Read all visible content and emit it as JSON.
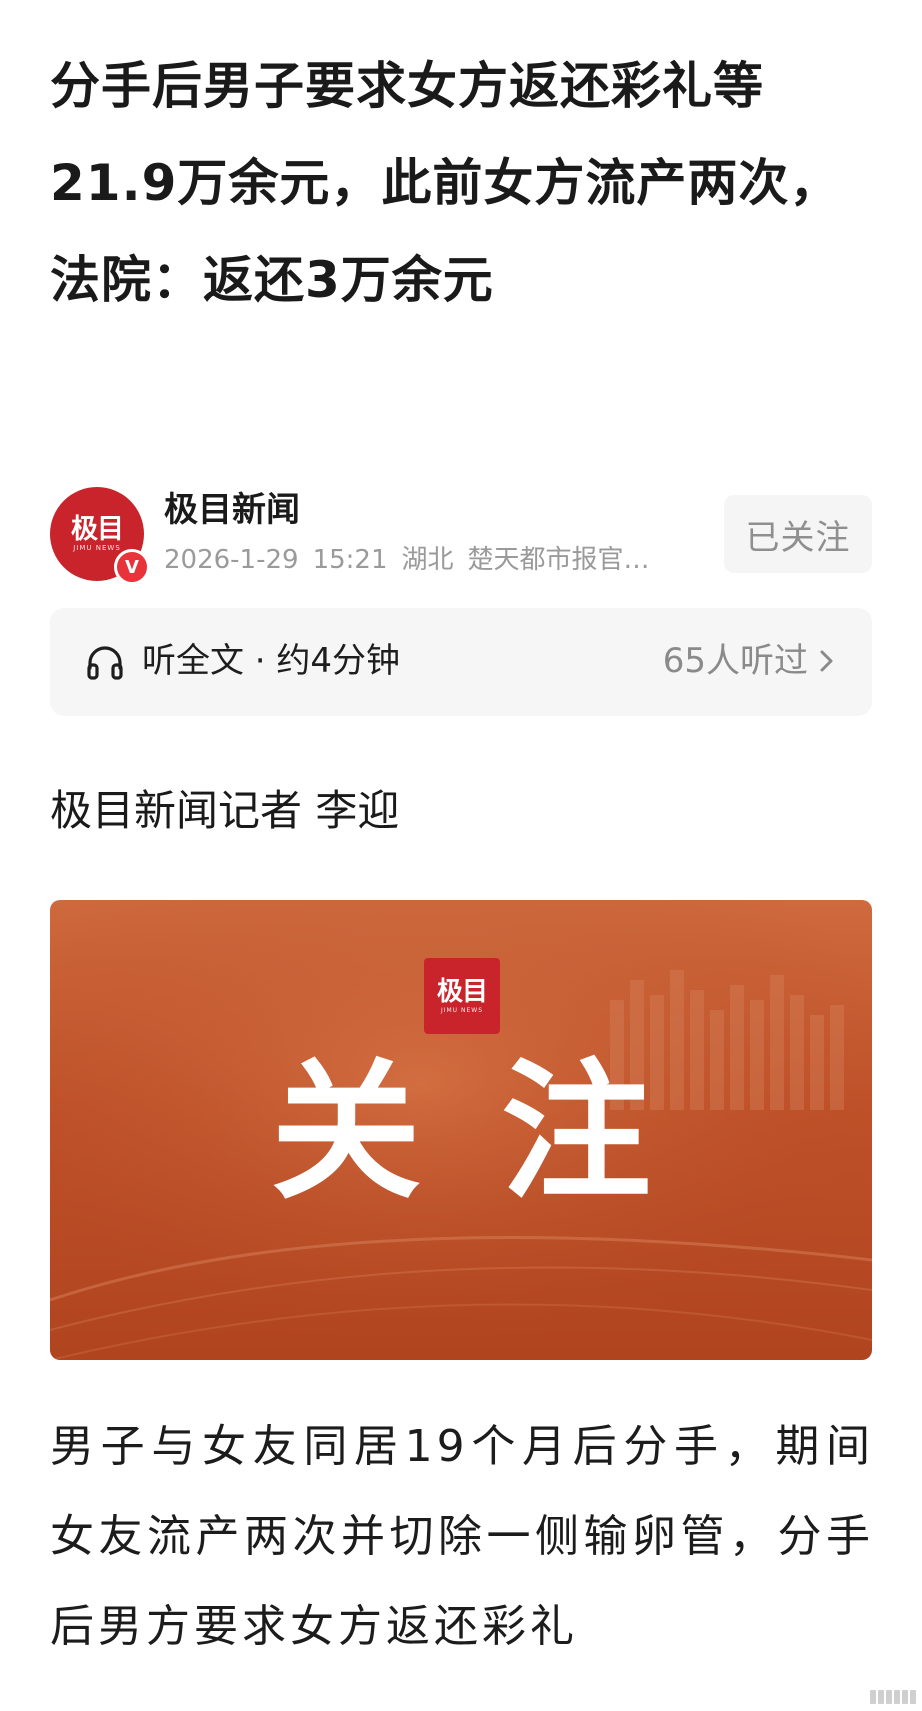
{
  "article": {
    "title": "分手后男子要求女方返还彩礼等21.9万余元，此前女方流产两次，法院：返还3万余元"
  },
  "author": {
    "name": "极目新闻",
    "avatar_logo": "极目",
    "avatar_sub": "JIMU NEWS",
    "verified_badge": "V",
    "date": "2026-1-29",
    "time": "15:21",
    "location": "湖北",
    "source": "楚天都市报官…",
    "follow_label": "已关注"
  },
  "audio": {
    "icon": "headphones-icon",
    "label": "听全文 · 约4分钟",
    "listeners": "65人听过"
  },
  "byline": "极目新闻记者 李迎",
  "banner": {
    "logo_text": "极目",
    "logo_sub": "JIMU NEWS",
    "headline": "关注"
  },
  "body": {
    "paragraph": "男子与女友同居19个月后分手，期间女友流产两次并切除一侧输卵管，分手后男方要求女方返还彩礼"
  },
  "colors": {
    "brand_red": "#c9242b",
    "banner_orange": "#bf5129",
    "meta_gray": "#9a9a9a"
  }
}
